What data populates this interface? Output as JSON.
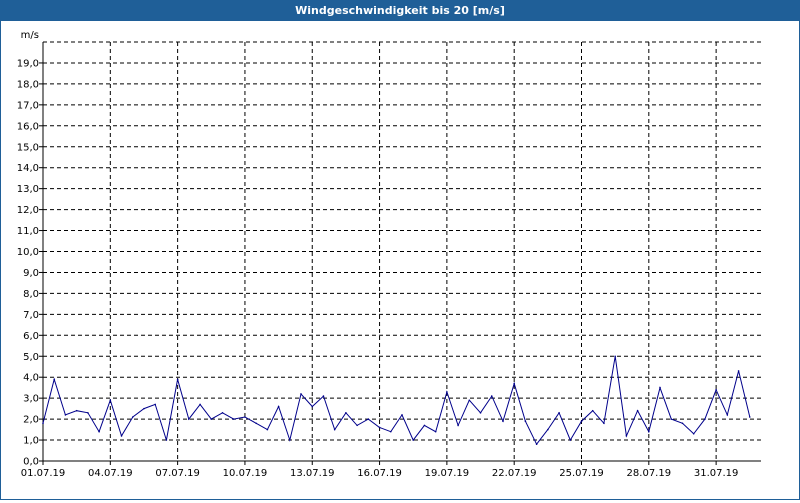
{
  "window": {
    "title": "Windgeschwindigkeit bis 20 [m/s]"
  },
  "chart_data": {
    "type": "line",
    "title": "Windgeschwindigkeit bis 20 [m/s]",
    "ylabel": "m/s",
    "xlabel": "",
    "ylim": [
      0,
      20
    ],
    "yticks": [
      "0,0",
      "1,0",
      "2,0",
      "3,0",
      "4,0",
      "5,0",
      "6,0",
      "7,0",
      "8,0",
      "9,0",
      "10,0",
      "11,0",
      "12,0",
      "13,0",
      "14,0",
      "15,0",
      "16,0",
      "17,0",
      "18,0",
      "19,0"
    ],
    "xlim": [
      "01.07.19 00:00",
      "02.08.19 00:00"
    ],
    "xticks": [
      "01.07.19",
      "04.07.19",
      "07.07.19",
      "10.07.19",
      "13.07.19",
      "16.07.19",
      "19.07.19",
      "22.07.19",
      "25.07.19",
      "28.07.19",
      "31.07.19"
    ],
    "grid": true,
    "line_color": "#00008b",
    "series": [
      {
        "name": "",
        "x": [
          "01.07.19 00:00",
          "01.07.19 12:00",
          "02.07.19 00:00",
          "02.07.19 12:00",
          "03.07.19 00:00",
          "03.07.19 12:00",
          "04.07.19 00:00",
          "04.07.19 12:00",
          "05.07.19 00:00",
          "05.07.19 12:00",
          "06.07.19 00:00",
          "06.07.19 12:00",
          "07.07.19 00:00",
          "07.07.19 12:00",
          "08.07.19 00:00",
          "08.07.19 12:00",
          "09.07.19 00:00",
          "09.07.19 12:00",
          "10.07.19 00:00",
          "10.07.19 12:00",
          "11.07.19 00:00",
          "11.07.19 12:00",
          "12.07.19 00:00",
          "12.07.19 12:00",
          "13.07.19 00:00",
          "13.07.19 12:00",
          "14.07.19 00:00",
          "14.07.19 12:00",
          "15.07.19 00:00",
          "15.07.19 12:00",
          "16.07.19 00:00",
          "16.07.19 12:00",
          "17.07.19 00:00",
          "17.07.19 12:00",
          "18.07.19 00:00",
          "18.07.19 12:00",
          "19.07.19 00:00",
          "19.07.19 12:00",
          "20.07.19 00:00",
          "20.07.19 12:00",
          "21.07.19 00:00",
          "21.07.19 12:00",
          "22.07.19 00:00",
          "22.07.19 12:00",
          "23.07.19 00:00",
          "23.07.19 12:00",
          "24.07.19 00:00",
          "24.07.19 12:00",
          "25.07.19 00:00",
          "25.07.19 12:00",
          "26.07.19 00:00",
          "26.07.19 12:00",
          "27.07.19 00:00",
          "27.07.19 12:00",
          "28.07.19 00:00",
          "28.07.19 12:00",
          "29.07.19 00:00",
          "29.07.19 12:00",
          "30.07.19 00:00",
          "30.07.19 12:00",
          "31.07.19 00:00",
          "31.07.19 12:00",
          "01.08.19 00:00",
          "01.08.19 12:00"
        ],
        "values": [
          1.8,
          3.9,
          2.2,
          2.4,
          2.3,
          1.4,
          2.9,
          1.2,
          2.1,
          2.5,
          2.7,
          1.0,
          3.9,
          2.0,
          2.7,
          2.0,
          2.3,
          2.0,
          2.1,
          1.8,
          1.5,
          2.6,
          1.0,
          3.2,
          2.6,
          3.1,
          1.5,
          2.3,
          1.7,
          2.0,
          1.6,
          1.4,
          2.2,
          1.0,
          1.7,
          1.4,
          3.3,
          1.7,
          2.9,
          2.3,
          3.1,
          1.9,
          3.7,
          1.9,
          0.8,
          1.5,
          2.3,
          1.0,
          1.9,
          2.4,
          1.8,
          5.0,
          1.2,
          2.4,
          1.4,
          3.5,
          2.0,
          1.8,
          1.3,
          2.0,
          3.4,
          2.2,
          4.3,
          2.1
        ]
      }
    ]
  }
}
